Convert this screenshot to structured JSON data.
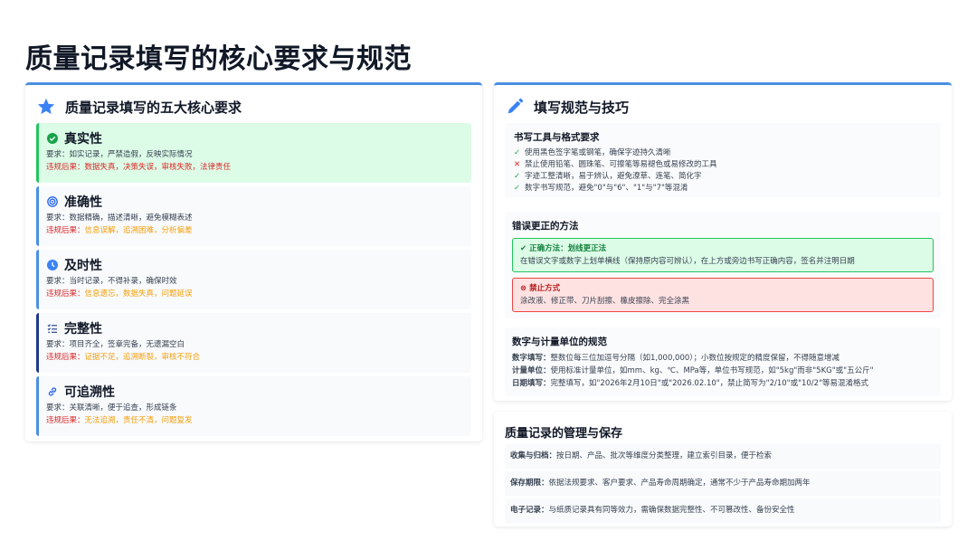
{
  "title": "质量记录填写的核心要求与规范",
  "left_panel": {
    "title": "质量记录填写的五大核心要求",
    "requirements": [
      {
        "name": "真实性",
        "req_label": "要求：",
        "req": "如实记录，严禁造假，反映实际情况",
        "cons_label": "违规后果：",
        "cons": "数据失真，决策失误，审核失败，法律责任"
      },
      {
        "name": "准确性",
        "req_label": "要求：",
        "req": "数据精确，描述清晰，避免模糊表述",
        "cons_label": "违规后果：",
        "cons": "信息误解，追溯困难，分析偏差"
      },
      {
        "name": "及时性",
        "req_label": "要求：",
        "req": "当时记录，不得补录，确保时效",
        "cons_label": "违规后果：",
        "cons": "信息遗忘，数据失真，问题延误"
      },
      {
        "name": "完整性",
        "req_label": "要求：",
        "req": "项目齐全，签章完备，无遗漏空白",
        "cons_label": "违规后果：",
        "cons": "证据不足，追溯断裂，审核不符合"
      },
      {
        "name": "可追溯性",
        "req_label": "要求：",
        "req": "关联清晰，便于追查，形成链条",
        "cons_label": "违规后果：",
        "cons": "无法追溯，责任不清，问题复发"
      }
    ]
  },
  "right_panel": {
    "title": "填写规范与技巧",
    "tools": {
      "title": "书写工具与格式要求",
      "items": [
        {
          "mark": "✓",
          "text": "使用黑色签字笔或钢笔，确保字迹持久清晰"
        },
        {
          "mark": "✕",
          "text": "禁止使用铅笔、圆珠笔、可擦笔等易褪色或易修改的工具"
        },
        {
          "mark": "✓",
          "text": "字迹工整清晰，易于辨认，避免潦草、连笔、简化字"
        },
        {
          "mark": "✓",
          "text": "数字书写规范，避免\"0\"与\"6\"、\"1\"与\"7\"等混淆"
        }
      ]
    },
    "correction": {
      "title": "错误更正的方法",
      "correct_title": "正确方法：划线更正法",
      "correct_text": "在错误文字或数字上划单横线（保持原内容可辨认），在上方或旁边书写正确内容，签名并注明日期",
      "forbidden_title": "禁止方式",
      "forbidden_text": "涂改液、修正带、刀片刮擦、橡皮擦除、完全涂黑"
    },
    "numbers": {
      "title": "数字与计量单位的规范",
      "lines": [
        {
          "k": "数字填写：",
          "v": "整数位每三位加逗号分隔（如1,000,000）；小数位按规定的精度保留，不得随意增减"
        },
        {
          "k": "计量单位：",
          "v": "使用标准计量单位，如mm、kg、℃、MPa等，单位书写规范，如\"5kg\"而非\"5KG\"或\"五公斤\""
        },
        {
          "k": "日期填写：",
          "v": "完整填写，如\"2026年2月10日\"或\"2026.02.10\"，禁止简写为\"2/10\"或\"10/2\"等易混淆格式"
        }
      ]
    }
  },
  "bottom_panel": {
    "title": "质量记录的管理与保存",
    "rows": [
      {
        "k": "收集与归档：",
        "v": "按日期、产品、批次等维度分类整理，建立索引目录，便于检索"
      },
      {
        "k": "保存期限：",
        "v": "依据法规要求、客户要求、产品寿命周期确定，通常不少于产品寿命期加两年"
      },
      {
        "k": "电子记录：",
        "v": "与纸质记录具有同等效力，需确保数据完整性、不可篡改性、备份安全性"
      }
    ]
  },
  "colors": {
    "accent": "#4a90e2",
    "green": "#22c55e",
    "red": "#dc2626",
    "orange": "#f59e0b"
  }
}
